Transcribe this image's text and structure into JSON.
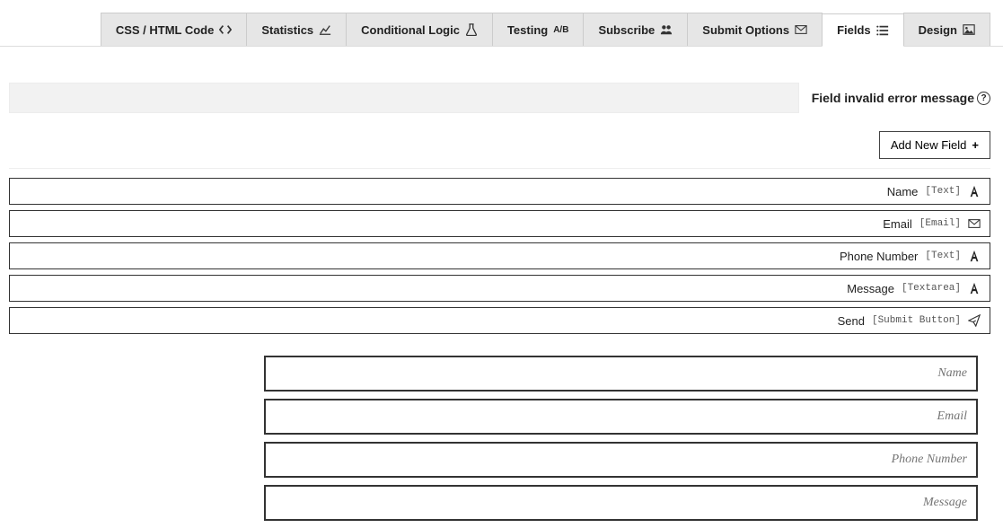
{
  "tabs": [
    {
      "label": "CSS / HTML Code",
      "icon": "code-icon"
    },
    {
      "label": "Statistics",
      "icon": "chart-icon"
    },
    {
      "label": "Conditional Logic",
      "icon": "flask-icon"
    },
    {
      "label": "Testing",
      "icon": "ab-icon",
      "suffix": "A/B"
    },
    {
      "label": "Subscribe",
      "icon": "users-icon"
    },
    {
      "label": "Submit Options",
      "icon": "envelope-icon"
    },
    {
      "label": "Fields",
      "icon": "list-icon",
      "active": true
    },
    {
      "label": "Design",
      "icon": "image-icon"
    }
  ],
  "error_label": "Field invalid error message",
  "add_button": "Add New Field",
  "fields": [
    {
      "name": "Name",
      "type": "[Text]",
      "icon": "font-icon"
    },
    {
      "name": "Email",
      "type": "[Email]",
      "icon": "envelope-icon"
    },
    {
      "name": "Phone Number",
      "type": "[Text]",
      "icon": "font-icon"
    },
    {
      "name": "Message",
      "type": "[Textarea]",
      "icon": "font-icon"
    },
    {
      "name": "Send",
      "type": "[Submit Button]",
      "icon": "paper-plane-icon"
    }
  ],
  "preview": {
    "placeholders": [
      "Name",
      "Email",
      "Phone Number",
      "Message"
    ]
  }
}
